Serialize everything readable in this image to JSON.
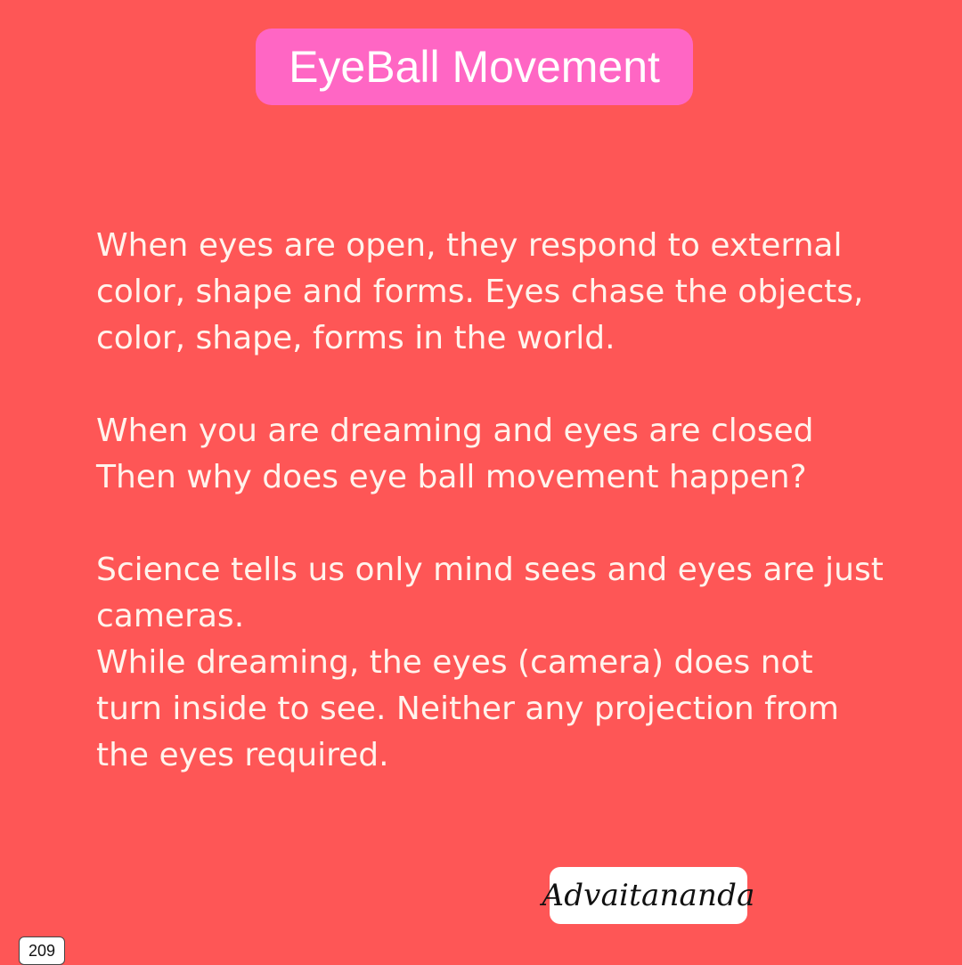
{
  "title": "EyeBall Movement",
  "paragraphs": [
    {
      "lines": [
        "When eyes are open, they respond to external",
        "color, shape and forms. Eyes chase the objects,",
        "color, shape, forms in the world."
      ]
    },
    {
      "lines": [
        "When you are dreaming and eyes are closed",
        "Then why does eye ball movement happen?"
      ]
    },
    {
      "lines": [
        "Science tells us only mind sees and eyes are just",
        "cameras.",
        "While dreaming, the eyes (camera) does not",
        "turn inside to see.  Neither any projection from",
        "the eyes required."
      ]
    }
  ],
  "signature": "Advaitananda",
  "page_number": "209",
  "colors": {
    "background": "#fe5656",
    "title_badge": "#ff66c4",
    "text": "#fff3ec"
  }
}
